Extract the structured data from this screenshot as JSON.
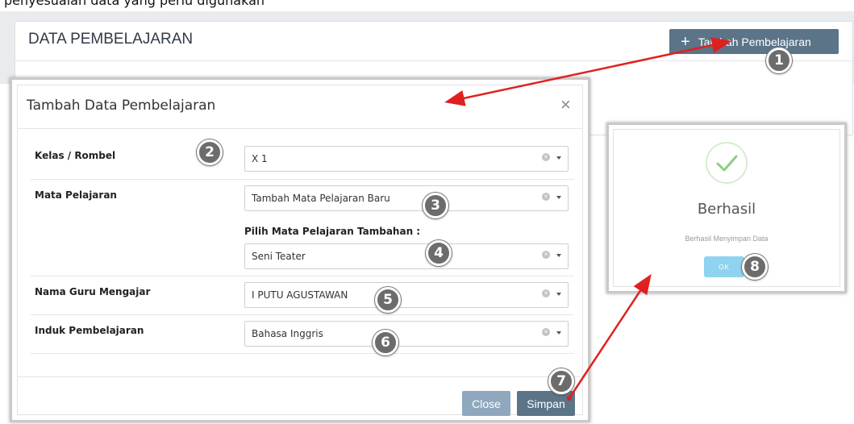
{
  "top_caption": "penyesuaian data yang perlu digunakan",
  "page": {
    "title": "DATA PEMBELAJARAN",
    "add_button": "Tambah Pembelajaran"
  },
  "modal": {
    "title": "Tambah Data Pembelajaran",
    "close_icon": "×",
    "fields": {
      "kelas_label": "Kelas / Rombel",
      "kelas_value": "X 1",
      "mapel_label": "Mata Pelajaran",
      "mapel_value": "Tambah Mata Pelajaran Baru",
      "tambahan_label": "Pilih Mata Pelajaran Tambahan :",
      "tambahan_value": "Seni Teater",
      "guru_label": "Nama Guru Mengajar",
      "guru_value": "I PUTU AGUSTAWAN",
      "induk_label": "Induk Pembelajaran",
      "induk_value": "Bahasa Inggris"
    },
    "close_button": "Close",
    "save_button": "Simpan"
  },
  "alert": {
    "icon": "check-icon",
    "title": "Berhasil",
    "message": "Berhasil Menyimpan Data",
    "ok_button": "OK"
  },
  "badges": [
    "1",
    "2",
    "3",
    "4",
    "5",
    "6",
    "7",
    "8"
  ],
  "colors": {
    "primary_button": "#5b7488",
    "secondary_button": "#8fa8bd",
    "ok_button": "#8fd3f0",
    "success_check": "#8ccf7e",
    "arrow": "#e02020",
    "badge": "#6c6c6c"
  }
}
